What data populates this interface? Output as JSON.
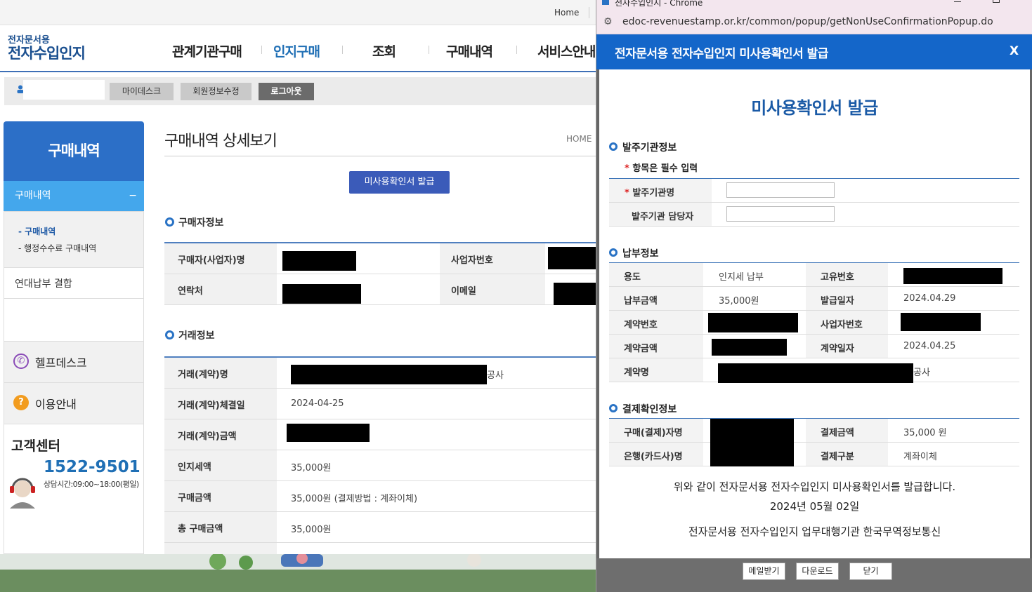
{
  "main": {
    "topbar": {
      "home": "Home"
    },
    "logo": {
      "line1": "전자문서용",
      "line2": "전자수입인지"
    },
    "gnb": [
      "관계기관구매",
      "인지구매",
      "조회",
      "구매내역",
      "서비스안내"
    ],
    "userbar": {
      "mydesk": "마이데스크",
      "edit": "회원정보수정",
      "logout": "로그아웃"
    },
    "sidebar": {
      "title": "구매내역",
      "active": "구매내역",
      "active_toggle": "−",
      "sub": [
        "- 구매내역",
        "- 행정수수료 구매내역"
      ],
      "item": "연대납부 결합",
      "helpdesk": "헬프데스크",
      "guide": "이용안내",
      "center_title": "고객센터",
      "phone": "1522-9501",
      "hours": "상담시간:09:00~18:00(평일)"
    },
    "content": {
      "title": "구매내역 상세보기",
      "breadcrumb": "HOME",
      "issue_button": "미사용확인서 발급",
      "buyer_section": "구매자정보",
      "buyer_rows": [
        {
          "l1": "구매자(사업자)명",
          "l2": "사업자번호"
        },
        {
          "l1": "연락처",
          "l2": "이메일"
        }
      ],
      "deal_section": "거래정보",
      "deal_rows": [
        {
          "label": "거래(계약)명",
          "value": "공사"
        },
        {
          "label": "거래(계약)체결일",
          "value": "2024-04-25"
        },
        {
          "label": "거래(계약)금액",
          "value": ""
        },
        {
          "label": "인지세액",
          "value": "35,000원"
        },
        {
          "label": "구매금액",
          "value": "35,000원 (결제방법 : 계좌이체)"
        },
        {
          "label": "총 구매금액",
          "value": "35,000원"
        }
      ]
    }
  },
  "popup": {
    "window_title": "전자수입인지 - Chrome",
    "url": "edoc-revenuestamp.or.kr/common/popup/getNonUseConfirmationPopup.do",
    "header": "전자문서용 전자수입인지 미사용확인서 발급",
    "close": "X",
    "heading": "미사용확인서 발급",
    "org_section": "발주기관정보",
    "required_note": "항목은 필수 입력",
    "required_mark": "*",
    "org_rows": [
      {
        "label": "발주기관명"
      },
      {
        "label": "발주기관 담당자"
      }
    ],
    "pay_section": "납부정보",
    "pay_rows": [
      {
        "l1": "용도",
        "v1": "인지세 납부",
        "l2": "고유번호",
        "v2": ""
      },
      {
        "l1": "납부금액",
        "v1": "35,000원",
        "l2": "발급일자",
        "v2": "2024.04.29"
      },
      {
        "l1": "계약번호",
        "v1": "",
        "l2": "사업자번호",
        "v2": ""
      },
      {
        "l1": "계약금액",
        "v1": "",
        "l2": "계약일자",
        "v2": "2024.04.25"
      },
      {
        "l1": "계약명",
        "v1": "공사"
      }
    ],
    "settle_section": "결제확인정보",
    "settle_rows": [
      {
        "l1": "구매(결제)자명",
        "l2": "결제금액",
        "v2": "35,000 원"
      },
      {
        "l1": "은행(카드사)명",
        "l2": "결제구분",
        "v2": "계좌이체"
      }
    ],
    "footer_line1": "위와 같이 전자문서용 전자수입인지 미사용확인서를 발급합니다.",
    "footer_date": "2024년 05월 02일",
    "footer_org": "전자문서용 전자수입인지 업무대행기관 한국무역정보통신",
    "buttons": {
      "mail": "메일받기",
      "download": "다운로드",
      "close": "닫기"
    }
  }
}
